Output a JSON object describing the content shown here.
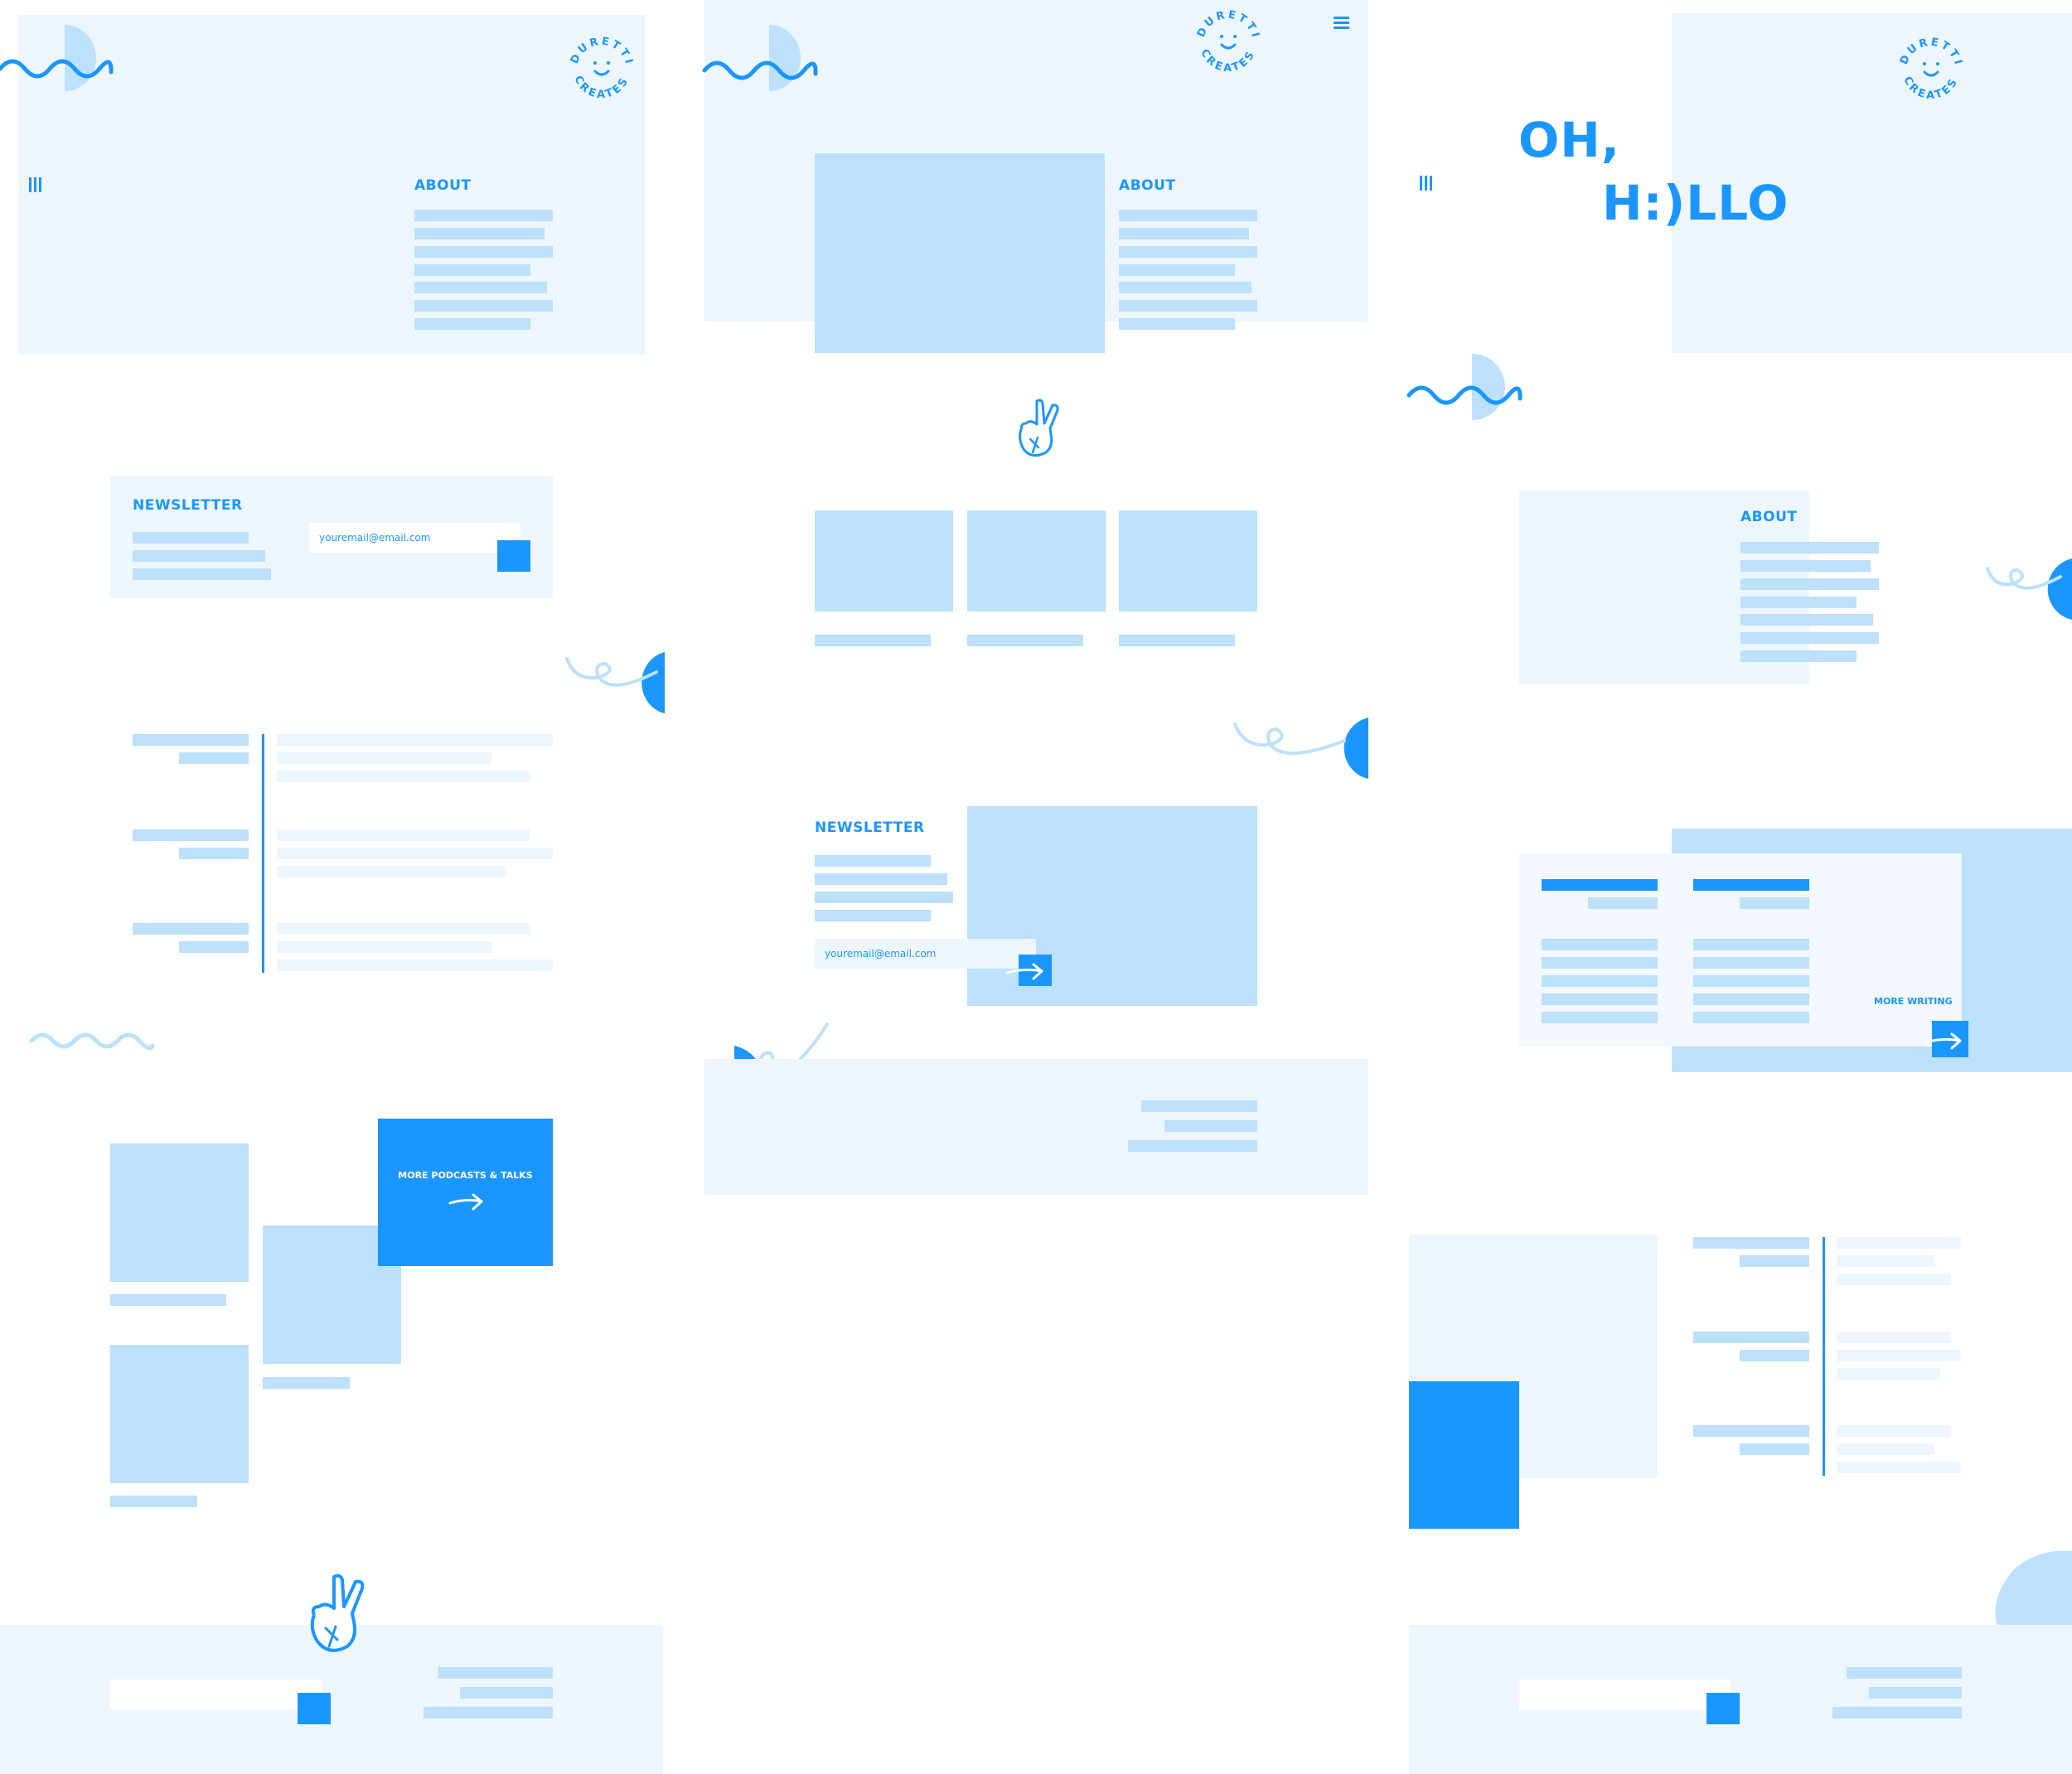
{
  "brand": {
    "logo_top": "DURETTI",
    "logo_bottom": "CREATES",
    "logo_icon": "smiley-face-icon"
  },
  "colors": {
    "primary": "#1a96ff",
    "light": "#bde0fb",
    "pale": "#eef6fd",
    "background": "#ffffff"
  },
  "frame1": {
    "menu_icon": "vertical-bars-menu-icon",
    "about_heading": "ABOUT",
    "newsletter_heading": "NEWSLETTER",
    "email_placeholder": "youremail@email.com",
    "podcasts_cta": "MORE PODCASTS & TALKS",
    "cta_icon": "arrow-right-icon",
    "hand_icon": "peace-hand-icon"
  },
  "frame2": {
    "menu_icon": "hamburger-menu-icon",
    "about_heading": "ABOUT",
    "newsletter_heading": "NEWSLETTER",
    "email_placeholder": "youremail@email.com",
    "submit_icon": "arrow-right-icon",
    "hand_icon": "peace-hand-icon"
  },
  "frame3": {
    "menu_icon": "vertical-bars-menu-icon",
    "hero_line1": "OH,",
    "hero_line2": "H:)LLO",
    "about_heading": "ABOUT",
    "writing_cta": "MORE WRITING",
    "cta_icon": "arrow-right-icon"
  }
}
